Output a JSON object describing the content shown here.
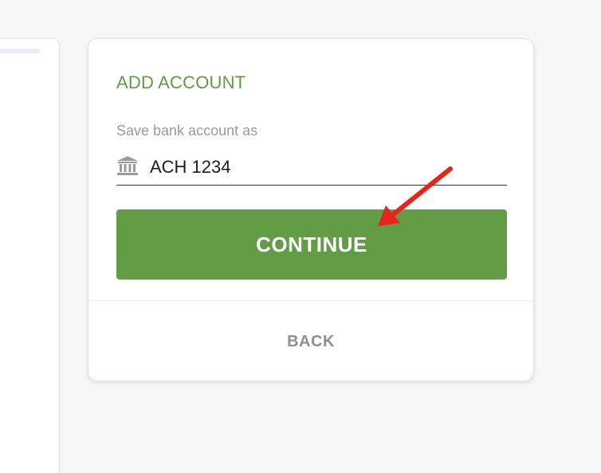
{
  "card": {
    "title": "ADD ACCOUNT",
    "field_label": "Save bank account as",
    "field_value": "ACH 1234",
    "field_icon": "bank-icon",
    "continue_label": "CONTINUE",
    "back_label": "BACK"
  },
  "colors": {
    "accent_green": "#629d46",
    "title_green": "#5f9b45",
    "arrow_red": "#e8231c"
  }
}
